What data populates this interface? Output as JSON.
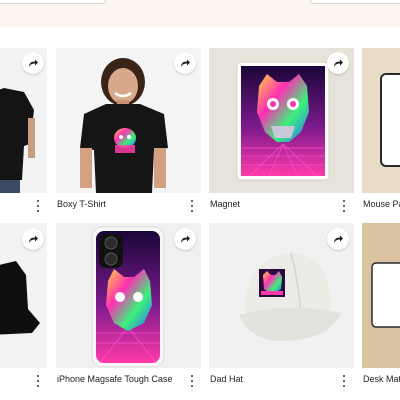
{
  "products": [
    {
      "label": "",
      "image": "black-tshirt-model-icon"
    },
    {
      "label": "Boxy T-Shirt",
      "image": "boxy-tshirt-model-icon"
    },
    {
      "label": "Magnet",
      "image": "magnet-icon"
    },
    {
      "label": "Mouse Pad",
      "image": "mouse-pad-icon"
    },
    {
      "label": "",
      "image": "bucket-hat-icon"
    },
    {
      "label": "iPhone Magsafe Tough Case",
      "image": "phone-case-icon"
    },
    {
      "label": "Dad Hat",
      "image": "dad-hat-icon"
    },
    {
      "label": "Desk Mat",
      "image": "desk-mat-icon"
    }
  ],
  "icons": {
    "share": "share-arrow-icon",
    "more": "more-options-icon"
  },
  "colors": {
    "top_band": "#fcf5ee",
    "tile_bg": "#f2f2f2",
    "neon_pink": "#ff2fb4",
    "neon_blue": "#2a6dff",
    "neon_yellow": "#ffd63a",
    "neon_green": "#3cf07a"
  }
}
